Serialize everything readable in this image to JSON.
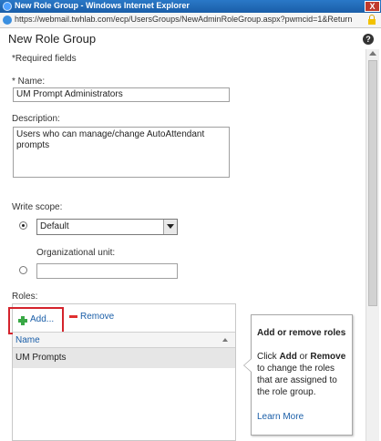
{
  "window": {
    "title": "New Role Group - Windows Internet Explorer",
    "close_glyph": "X"
  },
  "addressbar": {
    "url": "https://webmail.twhlab.com/ecp/UsersGroups/NewAdminRoleGroup.aspx?pwmcid=1&ReturnObjectTyp"
  },
  "dialog": {
    "title": "New Role Group",
    "help_glyph": "?"
  },
  "form": {
    "required_note": "*Required fields",
    "name_label": "* Name:",
    "name_value": "UM Prompt Administrators",
    "description_label": "Description:",
    "description_value": "Users who can manage/change AutoAttendant prompts",
    "write_scope_label": "Write scope:",
    "write_scope_selected": "Default",
    "org_unit_label": "Organizational unit:",
    "org_unit_value": ""
  },
  "roles": {
    "label": "Roles:",
    "add_label": "Add...",
    "remove_label": "Remove",
    "column_header": "Name",
    "rows": [
      "UM Prompts"
    ]
  },
  "callout": {
    "title": "Add or remove roles",
    "text_1": "Click ",
    "add_word": "Add",
    "text_2": " or ",
    "remove_word": "Remove",
    "text_3": " to change the roles that are assigned to the role group.",
    "link": "Learn More"
  },
  "colors": {
    "highlight_border": "#d4232c",
    "link": "#1a5ea8",
    "titlebar": "#1a5ea8"
  },
  "icons": [
    "ie-icon",
    "close-icon",
    "lock-icon",
    "help-icon",
    "plus-icon",
    "minus-icon",
    "sort-arrow-icon"
  ]
}
